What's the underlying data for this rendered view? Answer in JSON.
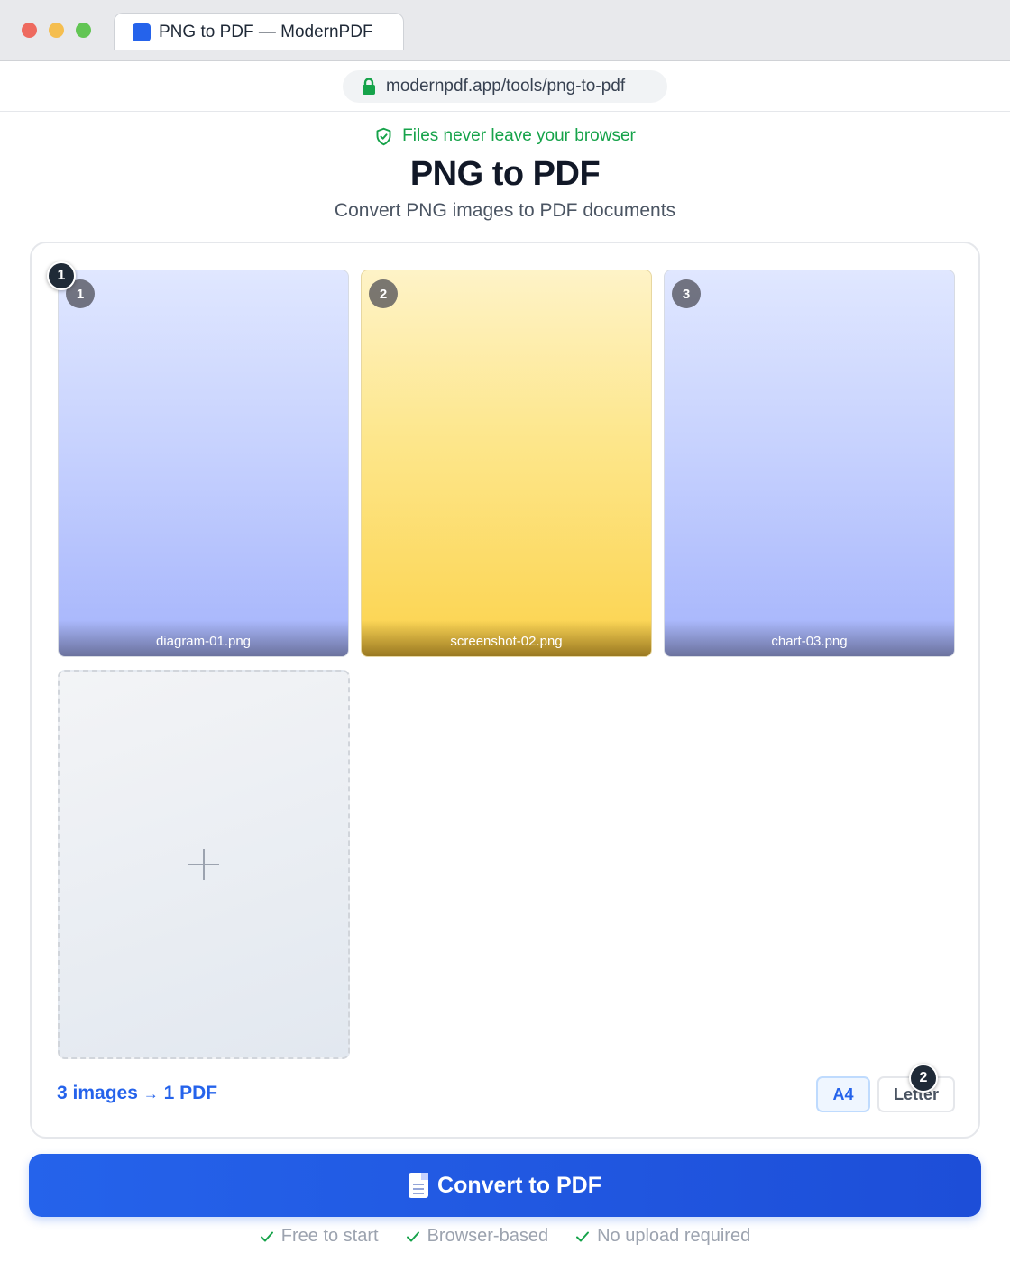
{
  "browser": {
    "tab_title": "PNG to PDF — ModernPDF",
    "url": "modernpdf.app/tools/png-to-pdf"
  },
  "header": {
    "privacy_note": "Files never leave your browser",
    "title": "PNG to PDF",
    "subtitle": "Convert PNG images to PDF documents"
  },
  "images": [
    {
      "index": "1",
      "filename": "diagram-01.png",
      "tint": "blue"
    },
    {
      "index": "2",
      "filename": "screenshot-02.png",
      "tint": "yellow"
    },
    {
      "index": "3",
      "filename": "chart-03.png",
      "tint": "blue"
    }
  ],
  "summary": {
    "images_count": "3 images",
    "arrow": "→",
    "result": "1 PDF"
  },
  "page_size": {
    "options": [
      "A4",
      "Letter"
    ],
    "selected": "A4"
  },
  "markers": [
    "1",
    "2"
  ],
  "convert_button": {
    "label": "Convert to PDF",
    "icon": "document-icon"
  },
  "features": [
    "Free to start",
    "Browser-based",
    "No upload required"
  ],
  "colors": {
    "accent": "#2563eb",
    "success": "#16a34a"
  }
}
